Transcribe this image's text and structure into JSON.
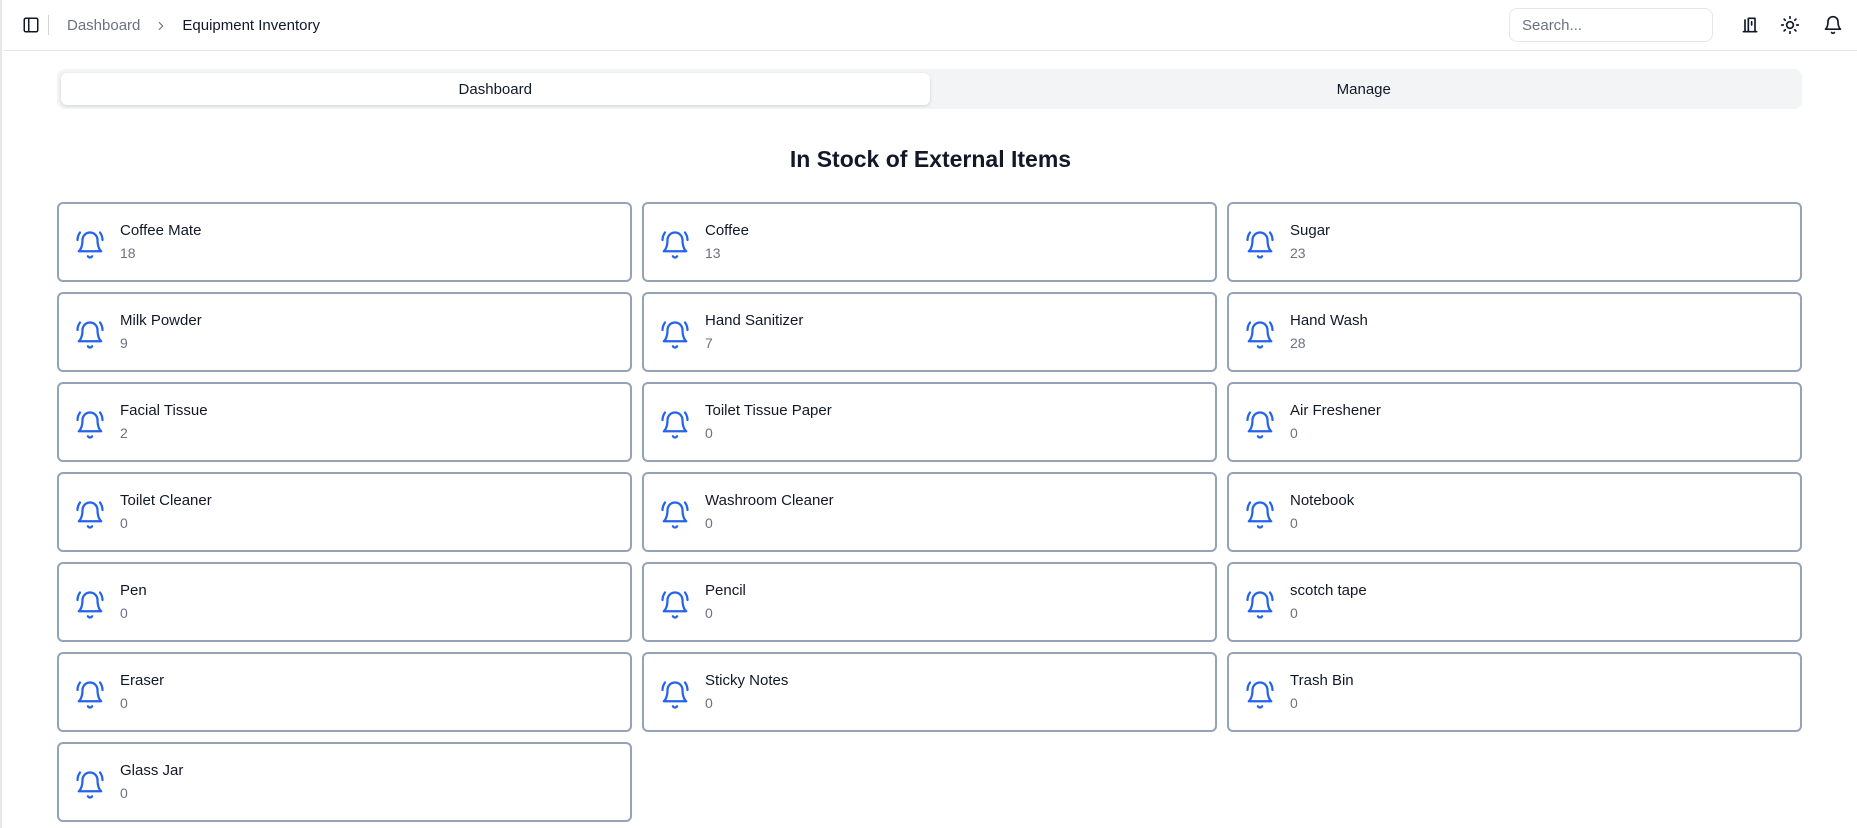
{
  "header": {
    "breadcrumb": {
      "parent": "Dashboard",
      "current": "Equipment Inventory"
    },
    "search_placeholder": "Search...",
    "icons": [
      "sidebar-toggle-icon",
      "chevron-right-icon",
      "library-icon",
      "sun-icon",
      "bell-icon"
    ]
  },
  "tabs": [
    {
      "label": "Dashboard",
      "active": true
    },
    {
      "label": "Manage",
      "active": false
    }
  ],
  "section_title": "In Stock of External Items",
  "accent_color": "#2563eb",
  "items": [
    {
      "name": "Coffee Mate",
      "qty": "18"
    },
    {
      "name": "Coffee",
      "qty": "13"
    },
    {
      "name": "Sugar",
      "qty": "23"
    },
    {
      "name": "Milk Powder",
      "qty": "9"
    },
    {
      "name": "Hand Sanitizer",
      "qty": "7"
    },
    {
      "name": "Hand Wash",
      "qty": "28"
    },
    {
      "name": "Facial Tissue",
      "qty": "2"
    },
    {
      "name": "Toilet Tissue Paper",
      "qty": "0"
    },
    {
      "name": "Air Freshener",
      "qty": "0"
    },
    {
      "name": "Toilet Cleaner",
      "qty": "0"
    },
    {
      "name": "Washroom Cleaner",
      "qty": "0"
    },
    {
      "name": "Notebook",
      "qty": "0"
    },
    {
      "name": "Pen",
      "qty": "0"
    },
    {
      "name": "Pencil",
      "qty": "0"
    },
    {
      "name": "scotch tape",
      "qty": "0"
    },
    {
      "name": "Eraser",
      "qty": "0"
    },
    {
      "name": "Sticky Notes",
      "qty": "0"
    },
    {
      "name": "Trash Bin",
      "qty": "0"
    },
    {
      "name": "Glass Jar",
      "qty": "0"
    }
  ]
}
